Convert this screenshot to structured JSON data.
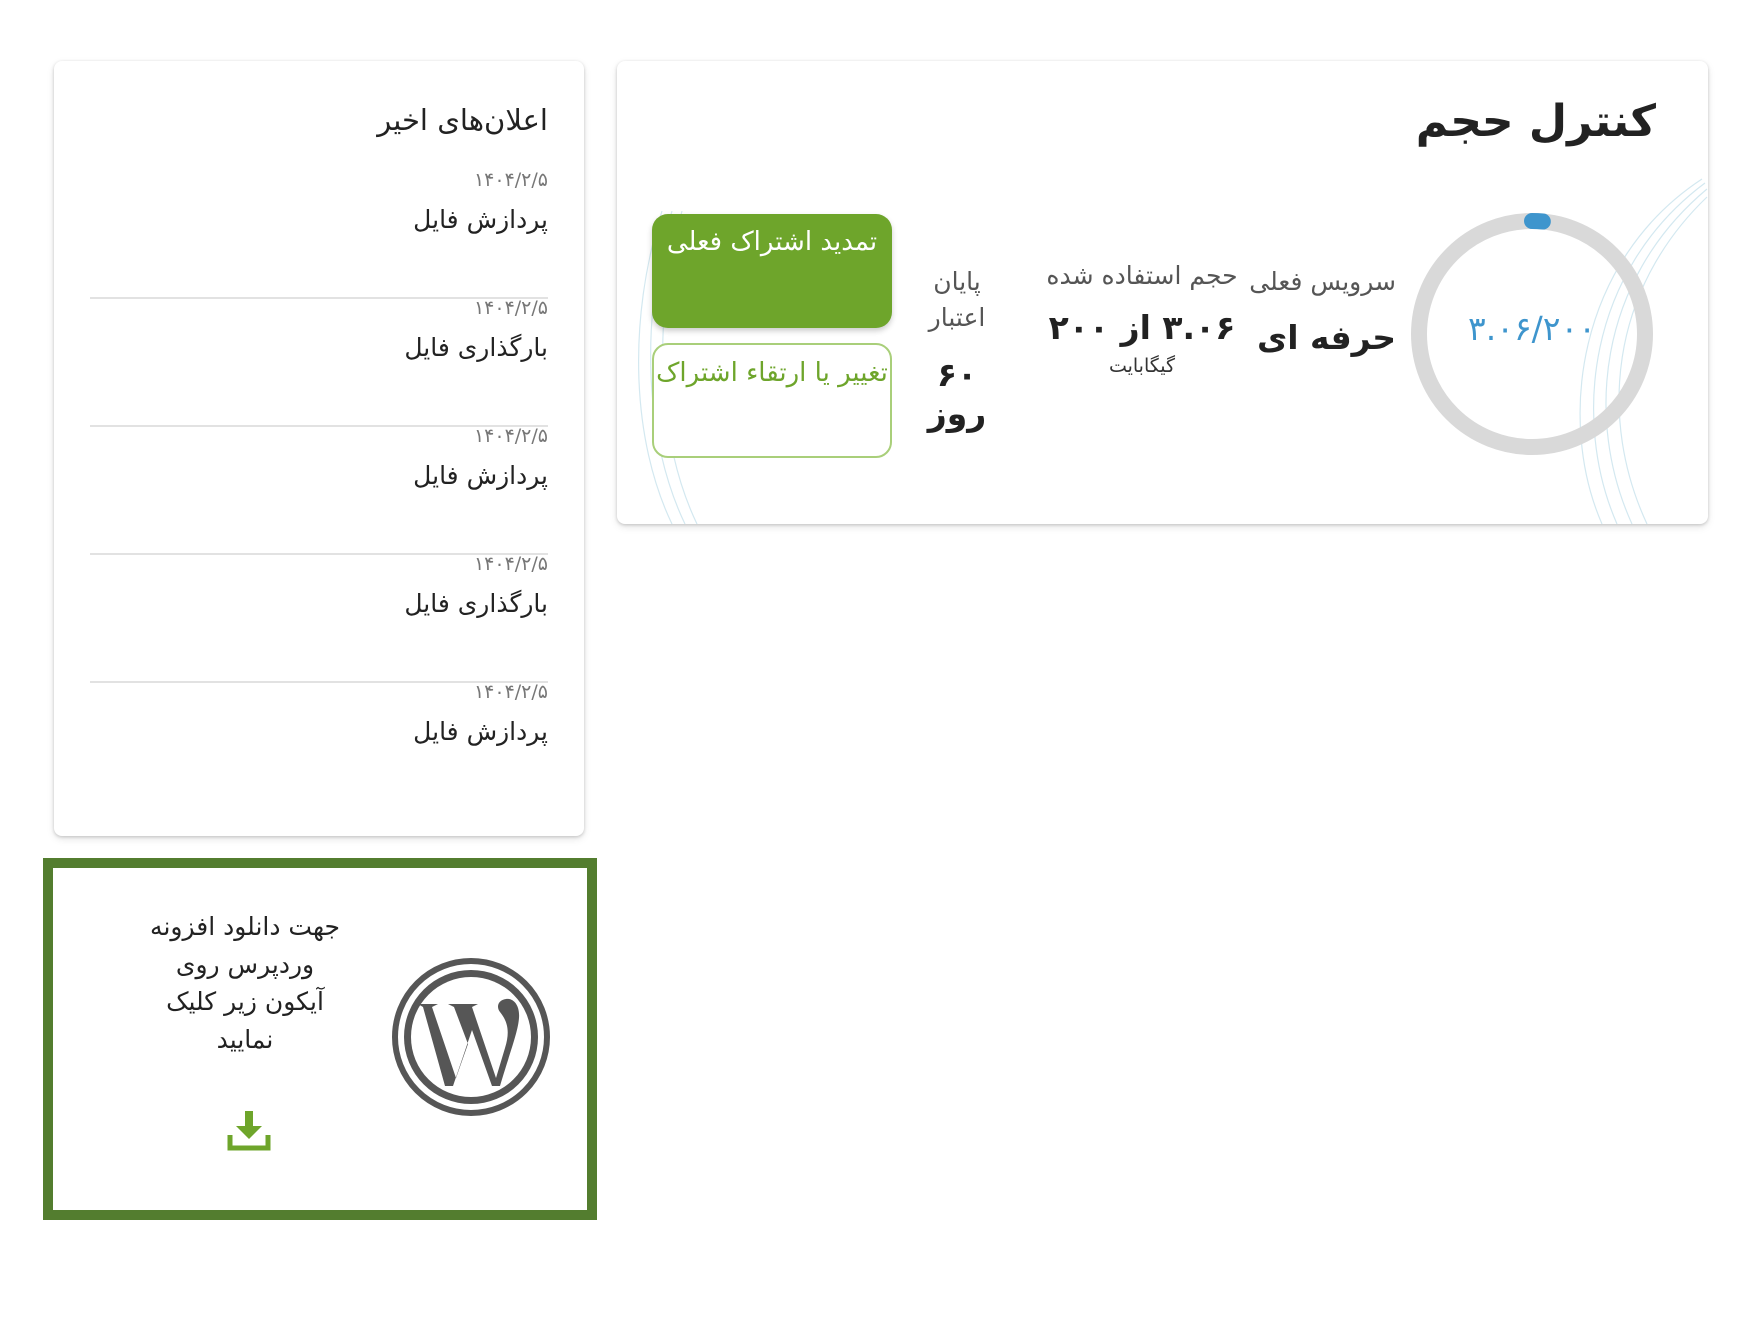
{
  "notifications": {
    "title": "اعلان‌های اخیر",
    "items": [
      {
        "date": "۱۴۰۴/۲/۵",
        "label": "پردازش فایل"
      },
      {
        "date": "۱۴۰۴/۲/۵",
        "label": "بارگذاری فایل"
      },
      {
        "date": "۱۴۰۴/۲/۵",
        "label": "پردازش فایل"
      },
      {
        "date": "۱۴۰۴/۲/۵",
        "label": "بارگذاری فایل"
      },
      {
        "date": "۱۴۰۴/۲/۵",
        "label": "پردازش فایل"
      }
    ]
  },
  "volume": {
    "title": "کنترل حجم",
    "usage_text": "۳.۰۶/۲۰۰",
    "usage_fraction": 0.0153,
    "used_gb": 3.06,
    "total_gb": 200,
    "service_label": "سرویس فعلی",
    "service_value": "حرفه ای",
    "used_label": "حجم استفاده شده",
    "used_value": "۳.۰۶ از ۲۰۰",
    "used_unit": "گیگابایت",
    "validity_label": "پایان اعتبار",
    "validity_value": "۶۰ روز",
    "renew_button": "تمدید اشتراک فعلی",
    "upgrade_button": "تغییر یا ارتقاء اشتراک"
  },
  "wordpress": {
    "text": "جهت دانلود افزونه وردپرس روی آیکون زیر کلیک نمایید",
    "logo_icon": "wordpress-logo-icon",
    "download_icon": "download-icon"
  },
  "colors": {
    "accent_green": "#6ea52b",
    "border_green": "#537d2f",
    "donut_blue": "#3e95cd",
    "donut_track": "#d9d9d9"
  }
}
